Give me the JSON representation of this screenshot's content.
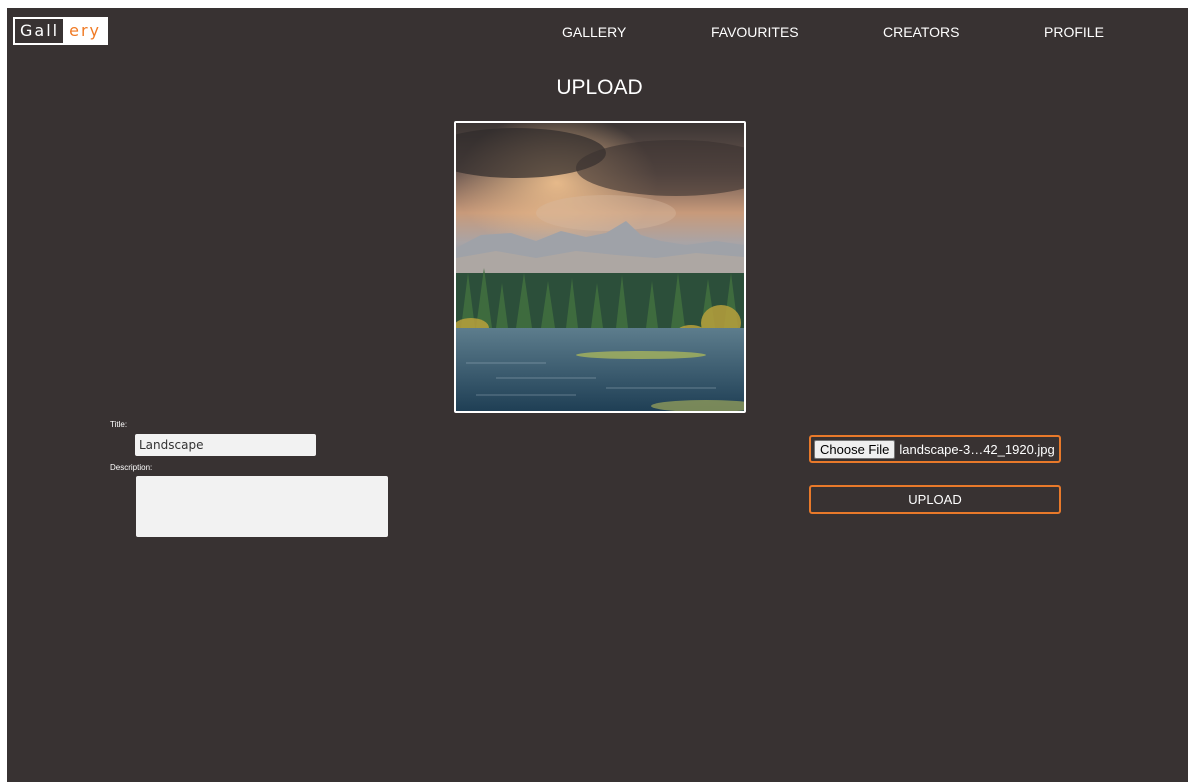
{
  "logo": {
    "part1": "Gall",
    "part2": "ery"
  },
  "nav": {
    "gallery": "GALLERY",
    "favourites": "FAVOURITES",
    "creators": "CREATORS",
    "profile": "PROFILE"
  },
  "page": {
    "title": "UPLOAD"
  },
  "form": {
    "title_label": "Title:",
    "title_value": "Landscape",
    "description_label": "Description:",
    "description_value": ""
  },
  "file": {
    "choose_label": "Choose File",
    "filename": "landscape-3…42_1920.jpg"
  },
  "actions": {
    "upload_label": "UPLOAD"
  },
  "colors": {
    "background": "#383232",
    "accent": "#e8792a",
    "logo_accent": "#f07a24",
    "text": "#ffffff",
    "input_bg": "#f2f2f2"
  },
  "icons": {
    "preview": "landscape-photo"
  }
}
